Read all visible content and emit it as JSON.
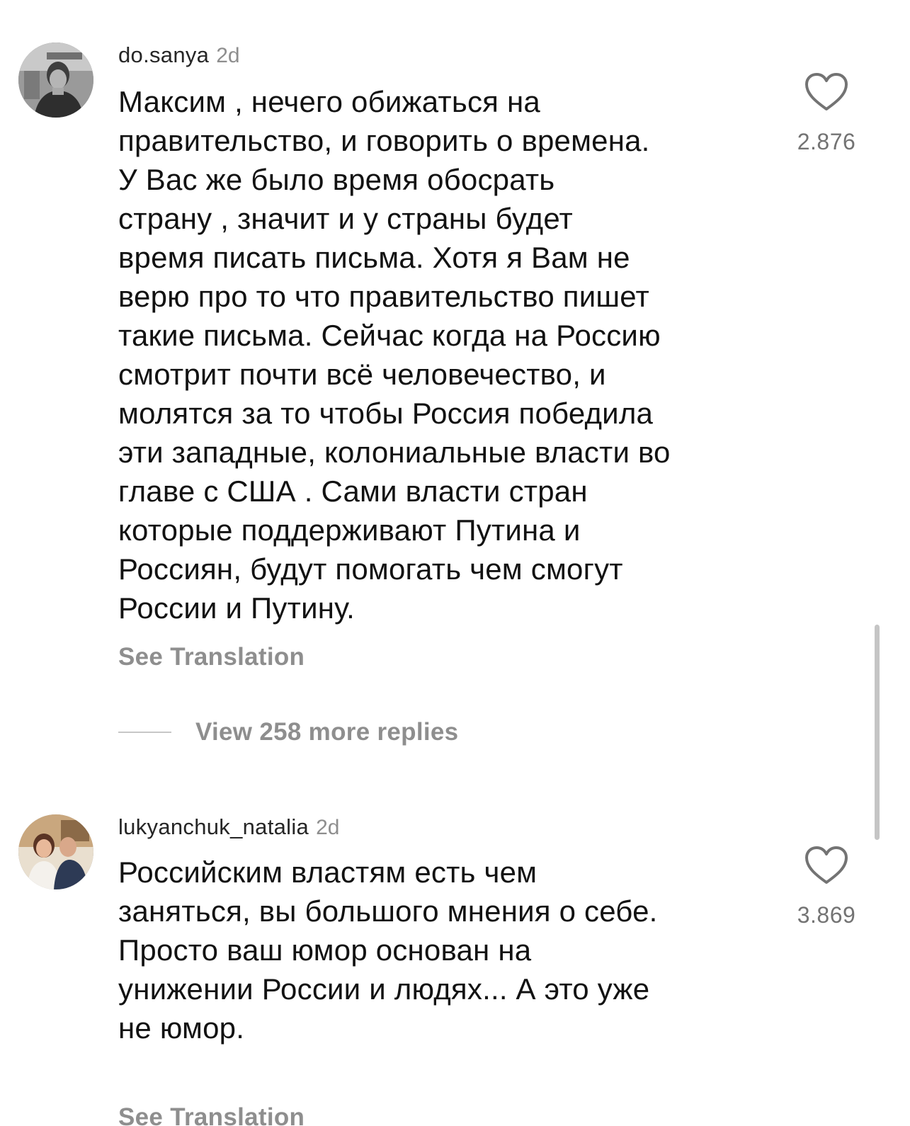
{
  "comments": [
    {
      "username": "do.sanya",
      "time": "2d",
      "text": "Максим , нечего обижаться на\nправительство, и говорить о времена.\nУ Вас же было время обосрать\nстрану , значит и у страны будет\nвремя писать письма. Хотя я Вам не\nверю про то что правительство пишет\nтакие письма. Сейчас когда на Россию\nсмотрит почти всё человечество, и\nмолятся за то чтобы Россия победила\nэти западные, колониальные власти во\nглаве с США . Сами власти стран\nкоторые поддерживают Путина и\nРоссиян, будут помогать чем смогут\nРоссии и Путину.",
      "likes": "2.876",
      "see_translation": "See Translation",
      "view_replies": "View 258 more replies",
      "avatar_icon": "avatar-photo-icon",
      "like_icon": "heart-outline-icon"
    },
    {
      "username": "lukyanchuk_natalia",
      "time": "2d",
      "text": "Российским властям есть чем\nзаняться, вы большого мнения о себе.\nПросто ваш юмор основан на\nунижении России и людях... А это уже\nне юмор.",
      "likes": "3.869",
      "see_translation": "See Translation",
      "avatar_icon": "avatar-photo-icon",
      "like_icon": "heart-outline-icon"
    }
  ],
  "colors": {
    "text_primary": "#121212",
    "text_secondary": "#8e8e8e",
    "count": "#737373",
    "background": "#ffffff"
  }
}
